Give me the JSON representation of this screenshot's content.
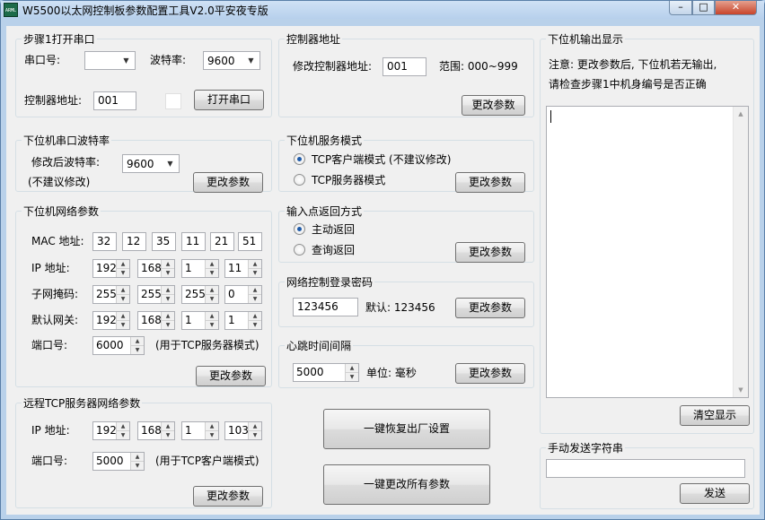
{
  "window": {
    "title": "W5500以太网控制板参数配置工具V2.0平安夜专版",
    "icon_text": "ARML",
    "min_glyph": "–",
    "max_glyph": "□",
    "close_glyph": "✕"
  },
  "step1": {
    "title": "步骤1打开串口",
    "port_label": "串口号:",
    "port_value": "",
    "baud_label": "波特率:",
    "baud_value": "9600",
    "addr_label": "控制器地址:",
    "addr_value": "001",
    "open_button": "打开串口"
  },
  "controller_addr": {
    "title": "控制器地址",
    "label": "修改控制器地址:",
    "value": "001",
    "range": "范围: 000~999",
    "button": "更改参数"
  },
  "output": {
    "title": "下位机输出显示",
    "note1": "注意: 更改参数后, 下位机若无输出,",
    "note2": "请检查步骤1中机身编号是否正确",
    "content": "",
    "clear_button": "清空显示"
  },
  "serial_baud": {
    "title": "下位机串口波特率",
    "label": "修改后波特率:",
    "value": "9600",
    "note": "(不建议修改)",
    "button": "更改参数"
  },
  "service_mode": {
    "title": "下位机服务模式",
    "option1": "TCP客户端模式 (不建议修改)",
    "option2": "TCP服务器模式",
    "selected": 1,
    "button": "更改参数"
  },
  "network": {
    "title": "下位机网络参数",
    "mac_label": "MAC 地址:",
    "mac": [
      "32",
      "12",
      "35",
      "11",
      "21",
      "51"
    ],
    "ip_label": "IP  地址:",
    "ip": [
      "192",
      "168",
      "1",
      "11"
    ],
    "mask_label": "子网掩码:",
    "mask": [
      "255",
      "255",
      "255",
      "0"
    ],
    "gateway_label": "默认网关:",
    "gateway": [
      "192",
      "168",
      "1",
      "1"
    ],
    "port_label": "端口号:",
    "port": "6000",
    "port_note": "(用于TCP服务器模式)",
    "button": "更改参数"
  },
  "input_return": {
    "title": "输入点返回方式",
    "option1": "主动返回",
    "option2": "查询返回",
    "selected": 1,
    "button": "更改参数"
  },
  "password": {
    "title": "网络控制登录密码",
    "value": "123456",
    "default": "默认: 123456",
    "button": "更改参数"
  },
  "heartbeat": {
    "title": "心跳时间间隔",
    "value": "5000",
    "unit": "单位: 毫秒",
    "button": "更改参数"
  },
  "remote": {
    "title": "远程TCP服务器网络参数",
    "ip_label": "IP  地址:",
    "ip": [
      "192",
      "168",
      "1",
      "103"
    ],
    "port_label": "端口号:",
    "port": "5000",
    "port_note": "(用于TCP客户端模式)",
    "button": "更改参数"
  },
  "actions": {
    "restore": "一键恢复出厂设置",
    "apply_all": "一键更改所有参数"
  },
  "manual_send": {
    "title": "手动发送字符串",
    "value": "",
    "button": "发送"
  }
}
